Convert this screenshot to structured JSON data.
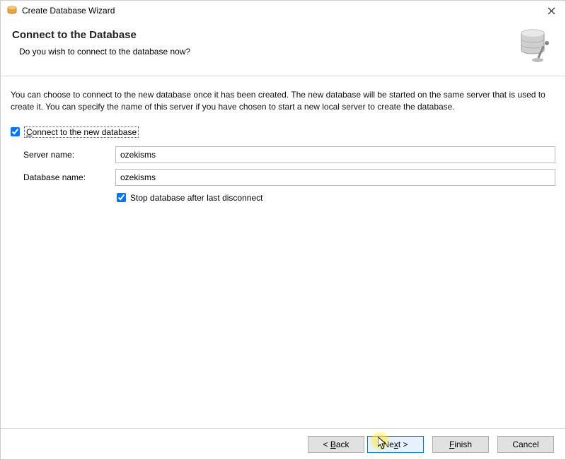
{
  "window": {
    "title": "Create Database Wizard"
  },
  "header": {
    "title": "Connect to the Database",
    "subtitle": "Do you wish to connect to the database now?"
  },
  "description": "You can choose to connect to the new database once it has been created. The new database will be started on the same server that is used to create it. You can specify the name of this server if you have chosen to start a new local server to create the database.",
  "connect_checkbox": {
    "label_before_underline": "",
    "underline_char": "C",
    "label_after_underline": "onnect to the new database",
    "checked": true
  },
  "fields": {
    "server_name": {
      "label_underline": "S",
      "label_rest": "erver name:",
      "value": "ozekisms"
    },
    "database_name": {
      "label_underline": "D",
      "label_rest": "atabase name:",
      "value": "ozekisms"
    }
  },
  "stop_checkbox": {
    "label": "Stop database after last disconnect",
    "checked": true
  },
  "buttons": {
    "back_pre": "< ",
    "back_u": "B",
    "back_post": "ack",
    "next_pre": "Ne",
    "next_u": "x",
    "next_post": "t >",
    "finish_pre": "",
    "finish_u": "F",
    "finish_post": "inish",
    "cancel": "Cancel"
  }
}
